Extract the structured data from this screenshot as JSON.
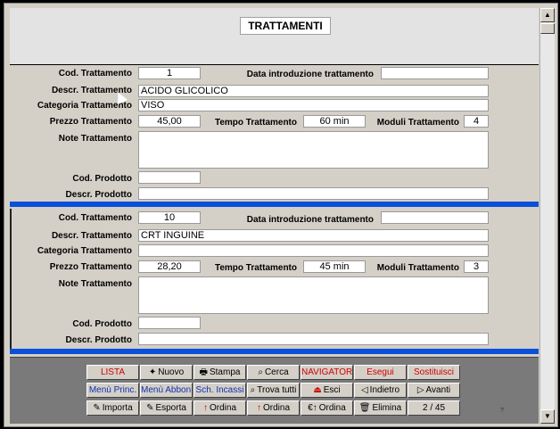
{
  "title": "TRATTAMENTI",
  "labels": {
    "cod_trattamento": "Cod. Trattamento",
    "data_introduzione": "Data introduzione trattamento",
    "descr_trattamento": "Descr. Trattamento",
    "categoria_trattamento": "Categoria Trattamento",
    "prezzo_trattamento": "Prezzo Trattamento",
    "tempo_trattamento": "Tempo Trattamento",
    "moduli_trattamento": "Moduli Trattamento",
    "note_trattamento": "Note Trattamento",
    "cod_prodotto": "Cod. Prodotto",
    "descr_prodotto": "Descr. Prodotto"
  },
  "records": [
    {
      "cod": "1",
      "data": "",
      "descr": "ACIDO GLICOLICO",
      "categoria": "VISO",
      "prezzo": "45,00",
      "tempo": "60 min",
      "moduli": "4",
      "note": "",
      "cod_prodotto": "",
      "descr_prodotto": ""
    },
    {
      "cod": "10",
      "data": "",
      "descr": "CRT INGUINE",
      "categoria": "",
      "prezzo": "28,20",
      "tempo": "45 min",
      "moduli": "3",
      "note": "",
      "cod_prodotto": "",
      "descr_prodotto": ""
    }
  ],
  "nav": {
    "lista": "LISTA",
    "nuovo": "Nuovo",
    "stampa": "Stampa",
    "cerca": "Cerca",
    "navigator": "NAVIGATOR",
    "esegui": "Esegui",
    "sostituisci": "Sostituisci",
    "menu_princ": "Menù  Princ.",
    "menu_abbon": "Menù Abbon.",
    "sch_incassi": "Sch. Incassi",
    "trova_tutti": "Trova tutti",
    "esci": "Esci",
    "indietro": "Indietro",
    "avanti": "Avanti",
    "importa": "Importa",
    "esporta": "Esporta",
    "ordina_az": "Ordina",
    "ordina_na": "Ordina",
    "ordina_eur": "Ordina",
    "elimina": "Elimina",
    "record_counter": "2 / 45"
  },
  "footer_mark": "?",
  "colors": {
    "separator": "#0a50d8",
    "navbar": "#7a7a7a",
    "red_label": "#d00000",
    "blue_label": "#1030b0"
  }
}
